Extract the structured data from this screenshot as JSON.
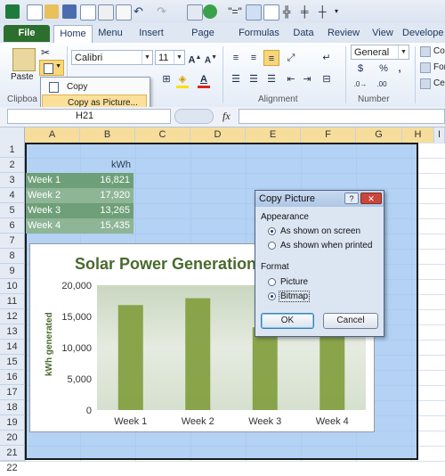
{
  "ribbon": {
    "tabs": [
      "File",
      "Home",
      "Menu",
      "Insert",
      "Page Layout",
      "Formulas",
      "Data",
      "Review",
      "View",
      "Develope"
    ],
    "clipboard_label": "Clipboa",
    "paste_label": "Paste",
    "font_name": "Calibri",
    "font_size": "11",
    "alignment_label": "Alignment",
    "number_label": "Number",
    "number_format": "General",
    "number_symbols": [
      "$",
      "%",
      ","
    ],
    "styles_items": [
      "Con",
      "For",
      "Cel"
    ]
  },
  "paste_menu": {
    "items": [
      "Copy",
      "Copy as Picture..."
    ]
  },
  "formula_bar": {
    "name_box": "H21",
    "fx": "fx"
  },
  "grid": {
    "columns": [
      "A",
      "B",
      "C",
      "D",
      "E",
      "F",
      "G",
      "H",
      "I"
    ],
    "rows": [
      "1",
      "2",
      "3",
      "4",
      "5",
      "6",
      "7",
      "8",
      "9",
      "10",
      "11",
      "12",
      "13",
      "14",
      "15",
      "16",
      "17",
      "18",
      "19",
      "20",
      "21",
      "22"
    ],
    "header_value": "kWh",
    "table": [
      {
        "label": "Week 1",
        "value": "16,821"
      },
      {
        "label": "Week 2",
        "value": "17,920"
      },
      {
        "label": "Week 3",
        "value": "13,265"
      },
      {
        "label": "Week 4",
        "value": "15,435"
      }
    ]
  },
  "chart_data": {
    "type": "bar",
    "title": "Solar Power Generation",
    "ylabel": "kWh generated",
    "xlabel": "",
    "categories": [
      "Week 1",
      "Week 2",
      "Week 3",
      "Week 4"
    ],
    "values": [
      16821,
      17920,
      13265,
      15435
    ],
    "ylim": [
      0,
      20000
    ],
    "yticks": [
      "0",
      "5,000",
      "10,000",
      "15,000",
      "20,000"
    ],
    "bar_color": "#7f9c3a",
    "grid": false,
    "legend": "none"
  },
  "dialog": {
    "title": "Copy Picture",
    "appearance_label": "Appearance",
    "appearance_options": [
      "As shown on screen",
      "As shown when printed"
    ],
    "format_label": "Format",
    "format_options": [
      "Picture",
      "Bitmap"
    ],
    "ok_label": "OK",
    "cancel_label": "Cancel",
    "help_icon": "?",
    "close_icon": "✕"
  },
  "colors": {
    "file_tab": "#2c6e2e",
    "selection": "#9bc3f0",
    "table_fill": "#6e9f78"
  }
}
